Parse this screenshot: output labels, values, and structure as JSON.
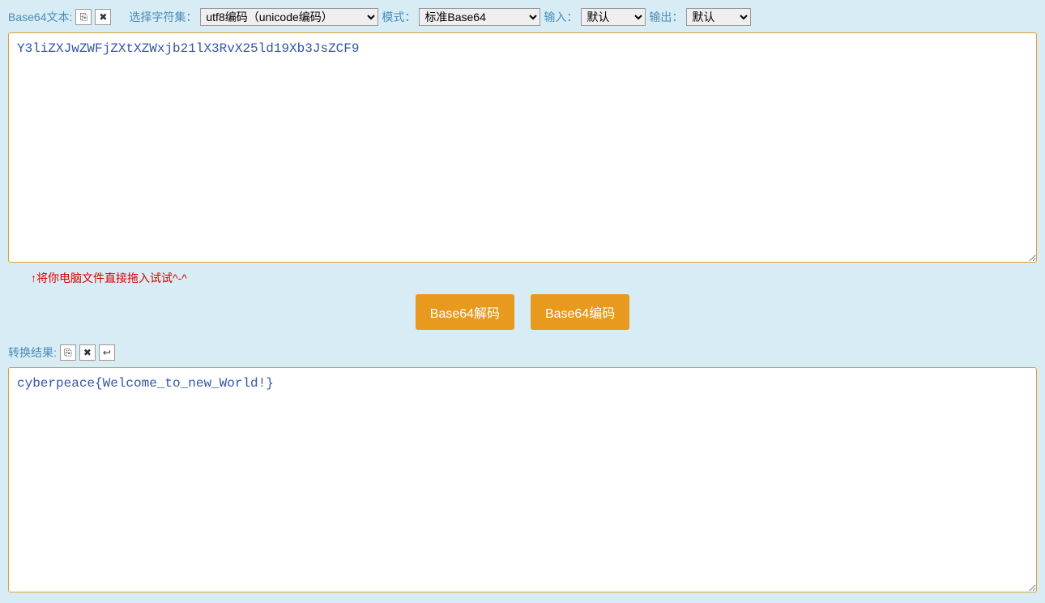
{
  "toolbar": {
    "input_label": "Base64文本:",
    "charset_label": "选择字符集：",
    "charset_value": "utf8编码（unicode编码）",
    "mode_label": "模式：",
    "mode_value": "标准Base64",
    "input_format_label": "输入：",
    "input_format_value": "默认",
    "output_format_label": "输出：",
    "output_format_value": "默认"
  },
  "input": {
    "value": "Y3liZXJwZWFjZXtXZWxjb21lX3RvX25ld19Xb3JsZCF9"
  },
  "hint": "↑将你电脑文件直接拖入试试^-^",
  "buttons": {
    "decode": "Base64解码",
    "encode": "Base64编码"
  },
  "result": {
    "label": "转换结果:",
    "value": "cyberpeace{Welcome_to_new_World!}"
  },
  "icons": {
    "copy": "⎘",
    "clear": "✖",
    "swap": "↩"
  }
}
